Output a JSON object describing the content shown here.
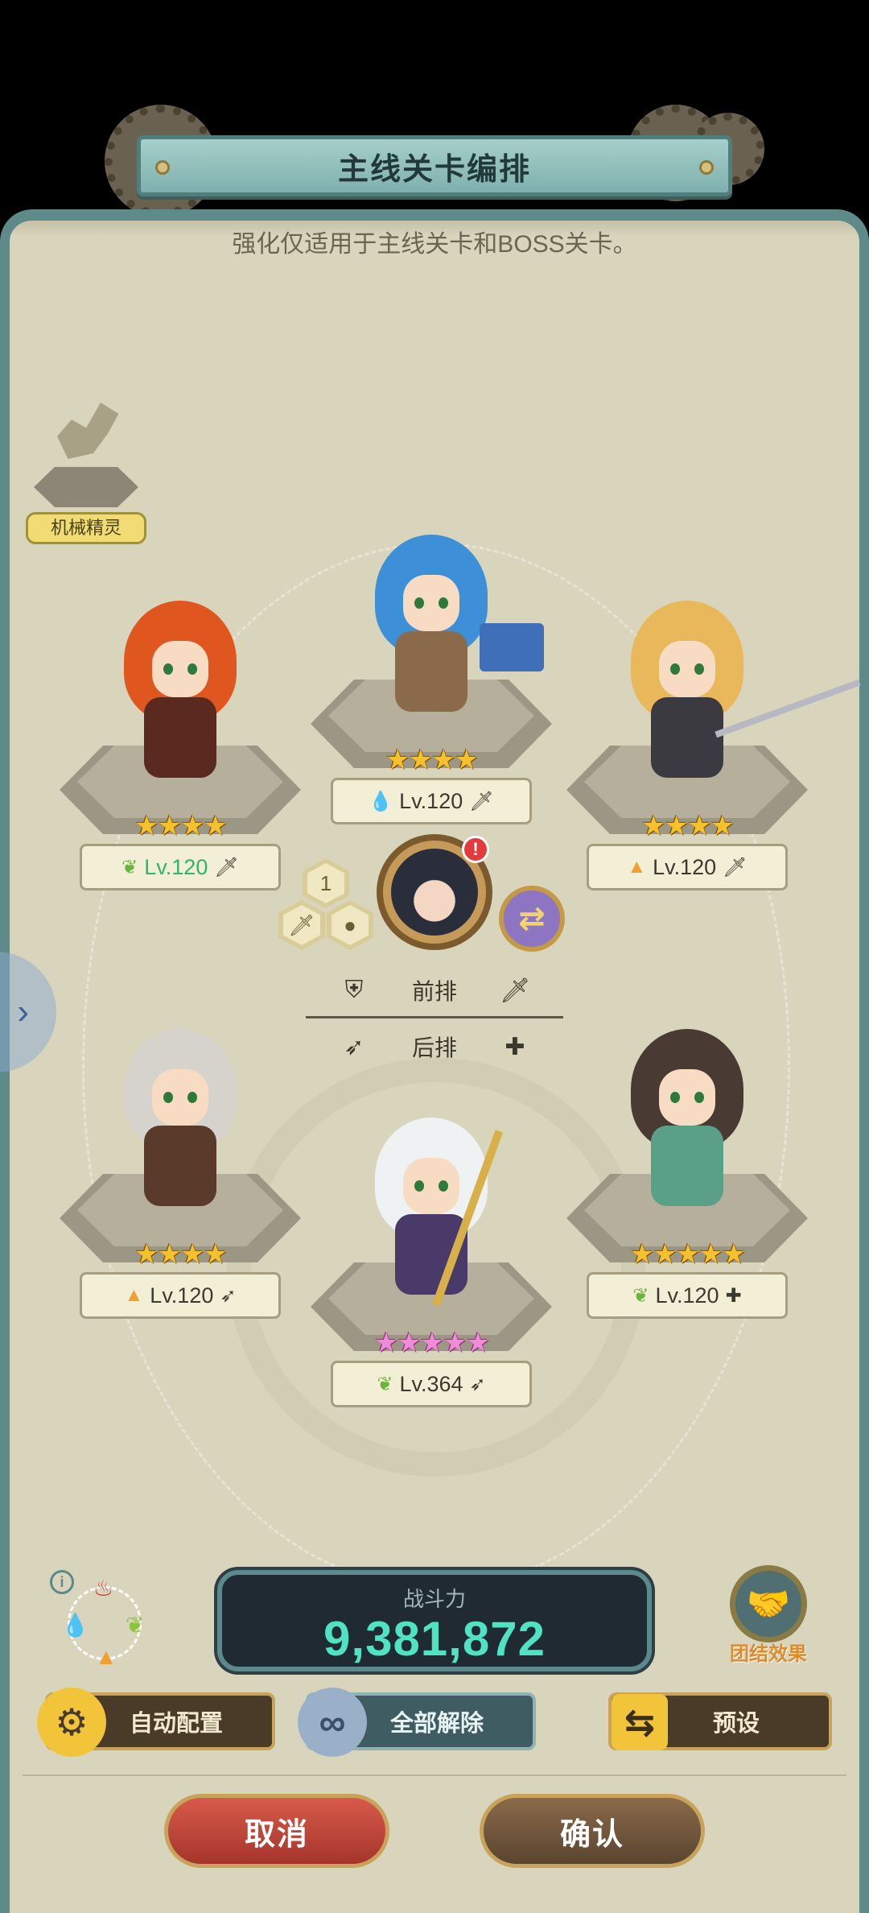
{
  "header": {
    "title": "主线关卡编排",
    "subtitle": "强化仅适用于主线关卡和BOSS关卡。"
  },
  "pet": {
    "label": "机械精灵"
  },
  "heroes": [
    {
      "slot": "front-left",
      "stars": "★★★★",
      "star_color": "gold",
      "element_icon": "leaf",
      "level": "Lv.120",
      "role_icon": "sword",
      "hair_color": "#e0561f",
      "torso_color": "#5a2a20"
    },
    {
      "slot": "front-center",
      "stars": "★★★★",
      "star_color": "gold",
      "element_icon": "water-drop",
      "level": "Lv.120",
      "role_icon": "sword",
      "hair_color": "#3d8fd8",
      "torso_color": "#8a6a4a"
    },
    {
      "slot": "front-right",
      "stars": "★★★★",
      "star_color": "gold",
      "element_icon": "fire",
      "level": "Lv.120",
      "role_icon": "sword",
      "hair_color": "#e8b85a",
      "torso_color": "#3a3a40"
    },
    {
      "slot": "back-left",
      "stars": "★★★★",
      "star_color": "gold",
      "element_icon": "fire",
      "level": "Lv.120",
      "role_icon": "bow",
      "hair_color": "#d6d2cc",
      "torso_color": "#5a3a2a"
    },
    {
      "slot": "back-center",
      "stars": "★★★★★",
      "star_color": "pink",
      "element_icon": "leaf",
      "level": "Lv.364",
      "role_icon": "bow",
      "hair_color": "#eef2f2",
      "torso_color": "#4a3a6a"
    },
    {
      "slot": "back-right",
      "stars": "★★★★★",
      "star_color": "gold",
      "element_icon": "leaf",
      "level": "Lv.120",
      "role_icon": "healer",
      "hair_color": "#4a3a34",
      "torso_color": "#5aa088"
    }
  ],
  "leader": {
    "alert": "!",
    "slot_number": "1"
  },
  "formation": {
    "front_label": "前排",
    "back_label": "后排"
  },
  "power": {
    "label": "战斗力",
    "value": "9,381,872"
  },
  "synergy": {
    "label": "团结效果"
  },
  "actions": {
    "auto_label": "自动配置",
    "clear_label": "全部解除",
    "preset_label": "预设",
    "cancel_label": "取消",
    "confirm_label": "确认"
  },
  "colors": {
    "accent_teal": "#5f8a8a",
    "power_green": "#4fe3c3",
    "cancel_red": "#c0453a",
    "confirm_brown": "#6e5438"
  }
}
